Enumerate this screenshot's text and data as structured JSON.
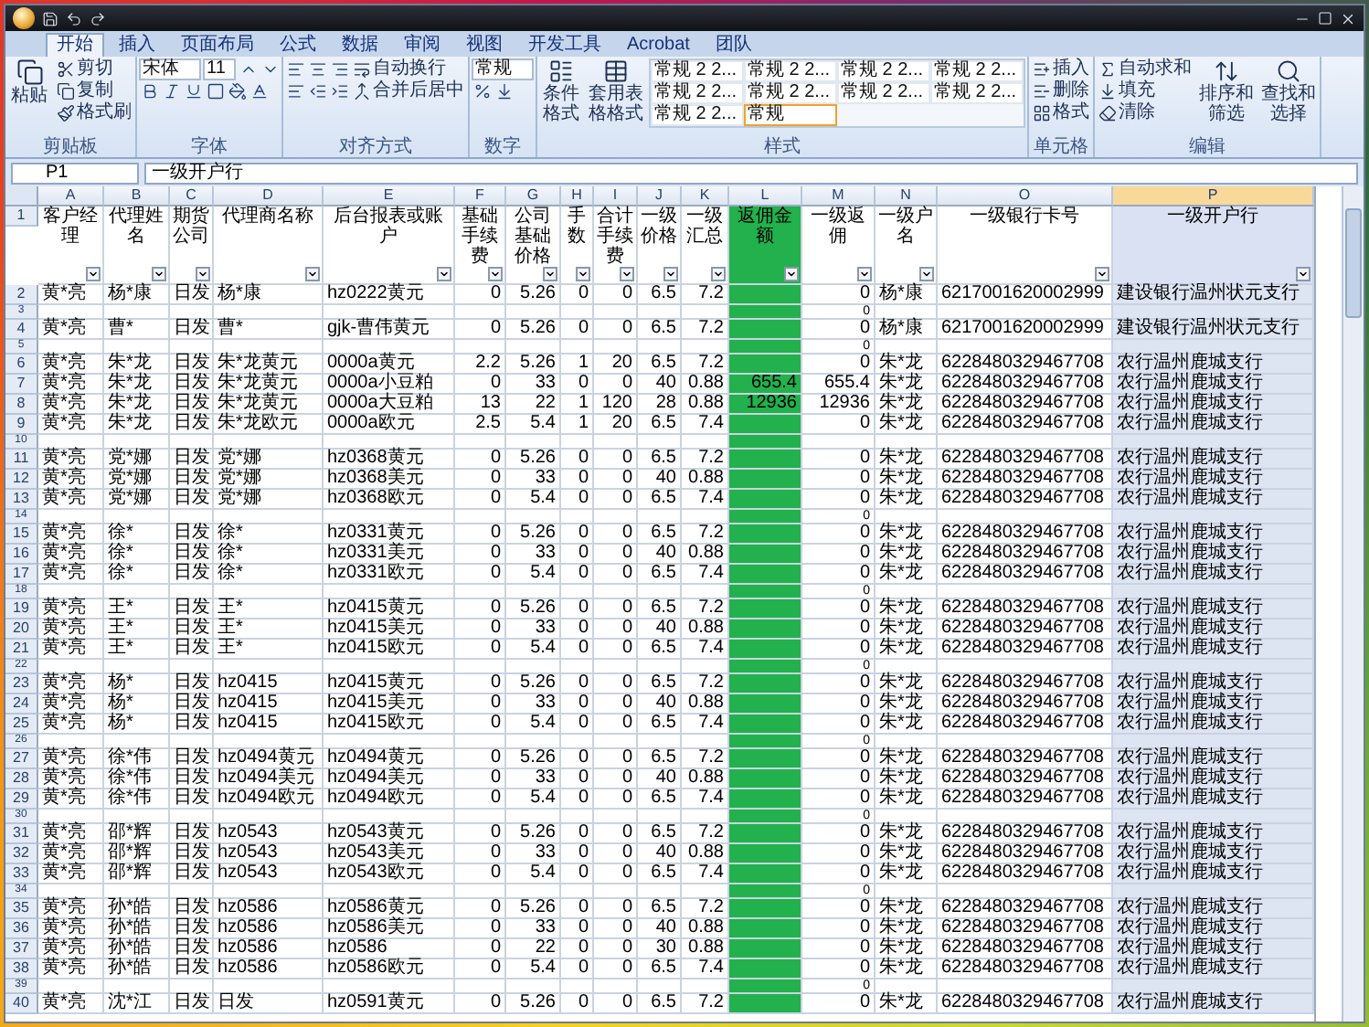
{
  "tabs": [
    {
      "label": "开始",
      "selected": true
    },
    {
      "label": "插入",
      "selected": false
    },
    {
      "label": "页面布局",
      "selected": false
    },
    {
      "label": "公式",
      "selected": false
    },
    {
      "label": "数据",
      "selected": false
    },
    {
      "label": "审阅",
      "selected": false
    },
    {
      "label": "视图",
      "selected": false
    },
    {
      "label": "开发工具",
      "selected": false
    },
    {
      "label": "Acrobat",
      "selected": false
    },
    {
      "label": "团队",
      "selected": false
    }
  ],
  "ribbon": {
    "clipboard": {
      "label": "剪贴板",
      "paste": "粘贴",
      "cut": "剪切",
      "copy": "复制",
      "format_painter": "格式刷"
    },
    "font": {
      "label": "字体",
      "font_name": "宋体",
      "font_size": "11"
    },
    "alignment": {
      "label": "对齐方式",
      "wrap": "自动换行",
      "merge": "合并后居中"
    },
    "number": {
      "label": "数字",
      "format": "常规"
    },
    "styles": {
      "label": "样式",
      "conditional": "条件格式",
      "table": "套用表格格式",
      "gallery": [
        {
          "label": "常规 2 2...",
          "selected": false
        },
        {
          "label": "常规 2 2...",
          "selected": false
        },
        {
          "label": "常规 2 2...",
          "selected": false
        },
        {
          "label": "常规 2 2...",
          "selected": false
        },
        {
          "label": "常规 2 2...",
          "selected": false
        },
        {
          "label": "常规 2 2...",
          "selected": false
        },
        {
          "label": "常规 2 2...",
          "selected": false
        },
        {
          "label": "常规 2 2...",
          "selected": false
        },
        {
          "label": "常规 2 2...",
          "selected": false
        },
        {
          "label": "常规",
          "selected": true
        }
      ]
    },
    "cells": {
      "label": "单元格",
      "insert": "插入",
      "delete": "删除",
      "format": "格式"
    },
    "editing": {
      "label": "编辑",
      "autosum": "自动求和",
      "fill": "填充",
      "clear": "清除",
      "sort": "排序和筛选",
      "find": "查找和选择"
    }
  },
  "formula_bar": {
    "name_box": "P1",
    "formula": "一级开户行"
  },
  "header_row_num": "1",
  "columns": [
    {
      "letter": "A",
      "header": "客户经理",
      "selected": false,
      "highlight": false
    },
    {
      "letter": "B",
      "header": "代理姓名",
      "selected": false,
      "highlight": false
    },
    {
      "letter": "C",
      "header": "期货公司",
      "selected": false,
      "highlight": false
    },
    {
      "letter": "D",
      "header": "代理商名称",
      "selected": false,
      "highlight": false
    },
    {
      "letter": "E",
      "header": "后台报表或账户",
      "selected": false,
      "highlight": false
    },
    {
      "letter": "F",
      "header": "基础手续费",
      "selected": false,
      "highlight": false
    },
    {
      "letter": "G",
      "header": "公司基础价格",
      "selected": false,
      "highlight": false
    },
    {
      "letter": "H",
      "header": "手数",
      "selected": false,
      "highlight": false
    },
    {
      "letter": "I",
      "header": "合计手续费",
      "selected": false,
      "highlight": false
    },
    {
      "letter": "J",
      "header": "一级价格",
      "selected": false,
      "highlight": false
    },
    {
      "letter": "K",
      "header": "一级汇总",
      "selected": false,
      "highlight": false
    },
    {
      "letter": "L",
      "header": "返佣金额",
      "selected": false,
      "highlight": true
    },
    {
      "letter": "M",
      "header": "一级返佣",
      "selected": false,
      "highlight": false
    },
    {
      "letter": "N",
      "header": "一级户名",
      "selected": false,
      "highlight": false
    },
    {
      "letter": "O",
      "header": "一级银行卡号",
      "selected": false,
      "highlight": false
    },
    {
      "letter": "P",
      "header": "一级开户行",
      "selected": true,
      "highlight": false
    }
  ],
  "rows": [
    {
      "num": "2",
      "kind": "data",
      "cells": {
        "a": "黄*亮",
        "b": "杨*康",
        "c": "日发",
        "d": "杨*康",
        "e": "hz0222黄元",
        "f": "0",
        "g": "5.26",
        "h": "0",
        "i": "0",
        "j": "6.5",
        "k": "7.2",
        "m": "0",
        "n": "杨*康",
        "o": "6217001620002999",
        "p": "建设银行温州状元支行"
      }
    },
    {
      "num": "3",
      "kind": "spacer",
      "cells": {
        "m": "0"
      }
    },
    {
      "num": "4",
      "kind": "data",
      "cells": {
        "a": "黄*亮",
        "b": "曹*",
        "c": "日发",
        "d": "曹*",
        "e": "gjk-曹伟黄元",
        "f": "0",
        "g": "5.26",
        "h": "0",
        "i": "0",
        "j": "6.5",
        "k": "7.2",
        "m": "0",
        "n": "杨*康",
        "o": "6217001620002999",
        "p": "建设银行温州状元支行"
      }
    },
    {
      "num": "5",
      "kind": "spacer",
      "cells": {
        "m": "0"
      }
    },
    {
      "num": "6",
      "kind": "data",
      "cells": {
        "a": "黄*亮",
        "b": "朱*龙",
        "c": "日发",
        "d": "朱*龙黄元",
        "e": "0000a黄元",
        "f": "2.2",
        "g": "5.26",
        "h": "1",
        "i": "20",
        "j": "6.5",
        "k": "7.2",
        "m": "0",
        "n": "朱*龙",
        "o": "6228480329467708",
        "p": "农行温州鹿城支行"
      }
    },
    {
      "num": "7",
      "kind": "data",
      "cells": {
        "a": "黄*亮",
        "b": "朱*龙",
        "c": "日发",
        "d": "朱*龙黄元",
        "e": "0000a小豆粕",
        "f": "0",
        "g": "33",
        "h": "0",
        "i": "0",
        "j": "40",
        "k": "0.88",
        "l": "655.4",
        "m": "655.4",
        "n": "朱*龙",
        "o": "6228480329467708",
        "p": "农行温州鹿城支行"
      }
    },
    {
      "num": "8",
      "kind": "data",
      "cells": {
        "a": "黄*亮",
        "b": "朱*龙",
        "c": "日发",
        "d": "朱*龙黄元",
        "e": "0000a大豆粕",
        "f": "13",
        "g": "22",
        "h": "1",
        "i": "120",
        "j": "28",
        "k": "0.88",
        "l": "12936",
        "m": "12936",
        "n": "朱*龙",
        "o": "6228480329467708",
        "p": "农行温州鹿城支行"
      }
    },
    {
      "num": "9",
      "kind": "data",
      "cells": {
        "a": "黄*亮",
        "b": "朱*龙",
        "c": "日发",
        "d": "朱*龙欧元",
        "e": "0000a欧元",
        "f": "2.5",
        "g": "5.4",
        "h": "1",
        "i": "20",
        "j": "6.5",
        "k": "7.4",
        "m": "0",
        "n": "朱*龙",
        "o": "6228480329467708",
        "p": "农行温州鹿城支行"
      }
    },
    {
      "num": "10",
      "kind": "spacer",
      "cells": {}
    },
    {
      "num": "11",
      "kind": "data",
      "cells": {
        "a": "黄*亮",
        "b": "党*娜",
        "c": "日发",
        "d": "党*娜",
        "e": "hz0368黄元",
        "f": "0",
        "g": "5.26",
        "h": "0",
        "i": "0",
        "j": "6.5",
        "k": "7.2",
        "m": "0",
        "n": "朱*龙",
        "o": "6228480329467708",
        "p": "农行温州鹿城支行"
      }
    },
    {
      "num": "12",
      "kind": "data",
      "cells": {
        "a": "黄*亮",
        "b": "党*娜",
        "c": "日发",
        "d": "党*娜",
        "e": "hz0368美元",
        "f": "0",
        "g": "33",
        "h": "0",
        "i": "0",
        "j": "40",
        "k": "0.88",
        "m": "0",
        "n": "朱*龙",
        "o": "6228480329467708",
        "p": "农行温州鹿城支行"
      }
    },
    {
      "num": "13",
      "kind": "data",
      "cells": {
        "a": "黄*亮",
        "b": "党*娜",
        "c": "日发",
        "d": "党*娜",
        "e": "hz0368欧元",
        "f": "0",
        "g": "5.4",
        "h": "0",
        "i": "0",
        "j": "6.5",
        "k": "7.4",
        "m": "0",
        "n": "朱*龙",
        "o": "6228480329467708",
        "p": "农行温州鹿城支行"
      }
    },
    {
      "num": "14",
      "kind": "spacer",
      "cells": {
        "m": "0"
      }
    },
    {
      "num": "15",
      "kind": "data",
      "cells": {
        "a": "黄*亮",
        "b": "徐*",
        "c": "日发",
        "d": "徐*",
        "e": "hz0331黄元",
        "f": "0",
        "g": "5.26",
        "h": "0",
        "i": "0",
        "j": "6.5",
        "k": "7.2",
        "m": "0",
        "n": "朱*龙",
        "o": "6228480329467708",
        "p": "农行温州鹿城支行"
      }
    },
    {
      "num": "16",
      "kind": "data",
      "cells": {
        "a": "黄*亮",
        "b": "徐*",
        "c": "日发",
        "d": "徐*",
        "e": "hz0331美元",
        "f": "0",
        "g": "33",
        "h": "0",
        "i": "0",
        "j": "40",
        "k": "0.88",
        "m": "0",
        "n": "朱*龙",
        "o": "6228480329467708",
        "p": "农行温州鹿城支行"
      }
    },
    {
      "num": "17",
      "kind": "data",
      "cells": {
        "a": "黄*亮",
        "b": "徐*",
        "c": "日发",
        "d": "徐*",
        "e": "hz0331欧元",
        "f": "0",
        "g": "5.4",
        "h": "0",
        "i": "0",
        "j": "6.5",
        "k": "7.4",
        "m": "0",
        "n": "朱*龙",
        "o": "6228480329467708",
        "p": "农行温州鹿城支行"
      }
    },
    {
      "num": "18",
      "kind": "spacer",
      "cells": {
        "m": "0"
      }
    },
    {
      "num": "19",
      "kind": "data",
      "cells": {
        "a": "黄*亮",
        "b": "王*",
        "c": "日发",
        "d": "王*",
        "e": "hz0415黄元",
        "f": "0",
        "g": "5.26",
        "h": "0",
        "i": "0",
        "j": "6.5",
        "k": "7.2",
        "m": "0",
        "n": "朱*龙",
        "o": "6228480329467708",
        "p": "农行温州鹿城支行"
      }
    },
    {
      "num": "20",
      "kind": "data",
      "cells": {
        "a": "黄*亮",
        "b": "王*",
        "c": "日发",
        "d": "王*",
        "e": "hz0415美元",
        "f": "0",
        "g": "33",
        "h": "0",
        "i": "0",
        "j": "40",
        "k": "0.88",
        "m": "0",
        "n": "朱*龙",
        "o": "6228480329467708",
        "p": "农行温州鹿城支行"
      }
    },
    {
      "num": "21",
      "kind": "data",
      "cells": {
        "a": "黄*亮",
        "b": "王*",
        "c": "日发",
        "d": "王*",
        "e": "hz0415欧元",
        "f": "0",
        "g": "5.4",
        "h": "0",
        "i": "0",
        "j": "6.5",
        "k": "7.4",
        "m": "0",
        "n": "朱*龙",
        "o": "6228480329467708",
        "p": "农行温州鹿城支行"
      }
    },
    {
      "num": "22",
      "kind": "spacer",
      "cells": {
        "m": "0"
      }
    },
    {
      "num": "23",
      "kind": "data",
      "cells": {
        "a": "黄*亮",
        "b": "杨*",
        "c": "日发",
        "d": "hz0415",
        "e": "hz0415黄元",
        "f": "0",
        "g": "5.26",
        "h": "0",
        "i": "0",
        "j": "6.5",
        "k": "7.2",
        "m": "0",
        "n": "朱*龙",
        "o": "6228480329467708",
        "p": "农行温州鹿城支行"
      }
    },
    {
      "num": "24",
      "kind": "data",
      "cells": {
        "a": "黄*亮",
        "b": "杨*",
        "c": "日发",
        "d": "hz0415",
        "e": "hz0415美元",
        "f": "0",
        "g": "33",
        "h": "0",
        "i": "0",
        "j": "40",
        "k": "0.88",
        "m": "0",
        "n": "朱*龙",
        "o": "6228480329467708",
        "p": "农行温州鹿城支行"
      }
    },
    {
      "num": "25",
      "kind": "data",
      "cells": {
        "a": "黄*亮",
        "b": "杨*",
        "c": "日发",
        "d": "hz0415",
        "e": "hz0415欧元",
        "f": "0",
        "g": "5.4",
        "h": "0",
        "i": "0",
        "j": "6.5",
        "k": "7.4",
        "m": "0",
        "n": "朱*龙",
        "o": "6228480329467708",
        "p": "农行温州鹿城支行"
      }
    },
    {
      "num": "26",
      "kind": "spacer",
      "cells": {
        "m": "0"
      }
    },
    {
      "num": "27",
      "kind": "data",
      "cells": {
        "a": "黄*亮",
        "b": "徐*伟",
        "c": "日发",
        "d": "hz0494黄元",
        "e": "hz0494黄元",
        "f": "0",
        "g": "5.26",
        "h": "0",
        "i": "0",
        "j": "6.5",
        "k": "7.2",
        "m": "0",
        "n": "朱*龙",
        "o": "6228480329467708",
        "p": "农行温州鹿城支行"
      }
    },
    {
      "num": "28",
      "kind": "data",
      "cells": {
        "a": "黄*亮",
        "b": "徐*伟",
        "c": "日发",
        "d": "hz0494美元",
        "e": "hz0494美元",
        "f": "0",
        "g": "33",
        "h": "0",
        "i": "0",
        "j": "40",
        "k": "0.88",
        "m": "0",
        "n": "朱*龙",
        "o": "6228480329467708",
        "p": "农行温州鹿城支行"
      }
    },
    {
      "num": "29",
      "kind": "data",
      "cells": {
        "a": "黄*亮",
        "b": "徐*伟",
        "c": "日发",
        "d": "hz0494欧元",
        "e": "hz0494欧元",
        "f": "0",
        "g": "5.4",
        "h": "0",
        "i": "0",
        "j": "6.5",
        "k": "7.4",
        "m": "0",
        "n": "朱*龙",
        "o": "6228480329467708",
        "p": "农行温州鹿城支行"
      }
    },
    {
      "num": "30",
      "kind": "spacer",
      "cells": {
        "m": "0"
      }
    },
    {
      "num": "31",
      "kind": "data",
      "cells": {
        "a": "黄*亮",
        "b": "邵*辉",
        "c": "日发",
        "d": "hz0543",
        "e": "hz0543黄元",
        "f": "0",
        "g": "5.26",
        "h": "0",
        "i": "0",
        "j": "6.5",
        "k": "7.2",
        "m": "0",
        "n": "朱*龙",
        "o": "6228480329467708",
        "p": "农行温州鹿城支行"
      }
    },
    {
      "num": "32",
      "kind": "data",
      "cells": {
        "a": "黄*亮",
        "b": "邵*辉",
        "c": "日发",
        "d": "hz0543",
        "e": "hz0543美元",
        "f": "0",
        "g": "33",
        "h": "0",
        "i": "0",
        "j": "40",
        "k": "0.88",
        "m": "0",
        "n": "朱*龙",
        "o": "6228480329467708",
        "p": "农行温州鹿城支行"
      }
    },
    {
      "num": "33",
      "kind": "data",
      "cells": {
        "a": "黄*亮",
        "b": "邵*辉",
        "c": "日发",
        "d": "hz0543",
        "e": "hz0543欧元",
        "f": "0",
        "g": "5.4",
        "h": "0",
        "i": "0",
        "j": "6.5",
        "k": "7.4",
        "m": "0",
        "n": "朱*龙",
        "o": "6228480329467708",
        "p": "农行温州鹿城支行"
      }
    },
    {
      "num": "34",
      "kind": "spacer",
      "cells": {
        "m": "0"
      }
    },
    {
      "num": "35",
      "kind": "data",
      "cells": {
        "a": "黄*亮",
        "b": "孙*皓",
        "c": "日发",
        "d": "hz0586",
        "e": "hz0586黄元",
        "f": "0",
        "g": "5.26",
        "h": "0",
        "i": "0",
        "j": "6.5",
        "k": "7.2",
        "m": "0",
        "n": "朱*龙",
        "o": "6228480329467708",
        "p": "农行温州鹿城支行"
      }
    },
    {
      "num": "36",
      "kind": "data",
      "cells": {
        "a": "黄*亮",
        "b": "孙*皓",
        "c": "日发",
        "d": "hz0586",
        "e": "hz0586美元",
        "f": "0",
        "g": "33",
        "h": "0",
        "i": "0",
        "j": "40",
        "k": "0.88",
        "m": "0",
        "n": "朱*龙",
        "o": "6228480329467708",
        "p": "农行温州鹿城支行"
      }
    },
    {
      "num": "37",
      "kind": "data",
      "cells": {
        "a": "黄*亮",
        "b": "孙*皓",
        "c": "日发",
        "d": "hz0586",
        "e": "hz0586",
        "f": "0",
        "g": "22",
        "h": "0",
        "i": "0",
        "j": "30",
        "k": "0.88",
        "m": "0",
        "n": "朱*龙",
        "o": "6228480329467708",
        "p": "农行温州鹿城支行"
      }
    },
    {
      "num": "38",
      "kind": "data",
      "cells": {
        "a": "黄*亮",
        "b": "孙*皓",
        "c": "日发",
        "d": "hz0586",
        "e": "hz0586欧元",
        "f": "0",
        "g": "5.4",
        "h": "0",
        "i": "0",
        "j": "6.5",
        "k": "7.4",
        "m": "0",
        "n": "朱*龙",
        "o": "6228480329467708",
        "p": "农行温州鹿城支行"
      }
    },
    {
      "num": "39",
      "kind": "spacer",
      "cells": {
        "m": "0"
      }
    },
    {
      "num": "40",
      "kind": "data",
      "cells": {
        "a": "黄*亮",
        "b": "沈*江",
        "c": "日发",
        "d": "日发",
        "e": "hz0591黄元",
        "f": "0",
        "g": "5.26",
        "h": "0",
        "i": "0",
        "j": "6.5",
        "k": "7.2",
        "m": "0",
        "n": "朱*龙",
        "o": "6228480329467708",
        "p": "农行温州鹿城支行"
      }
    }
  ]
}
